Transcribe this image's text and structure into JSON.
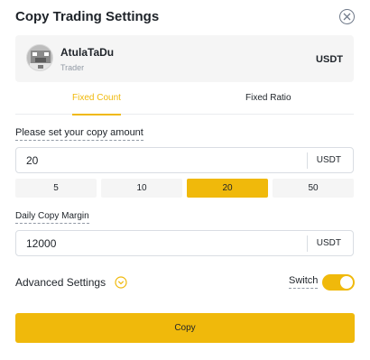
{
  "modal": {
    "title": "Copy Trading Settings",
    "close_icon": "close-circle-icon"
  },
  "trader": {
    "name": "AtulaTaDu",
    "role": "Trader",
    "asset": "USDT",
    "avatar_icon": "pixel-avatar"
  },
  "tabs": [
    {
      "label": "Fixed Count",
      "active": true
    },
    {
      "label": "Fixed Ratio",
      "active": false
    }
  ],
  "amount": {
    "label": "Please set your copy amount",
    "value": "20",
    "unit": "USDT",
    "presets": [
      "5",
      "10",
      "20",
      "50"
    ],
    "selected_preset": "20"
  },
  "margin": {
    "label": "Daily Copy Margin",
    "value": "12000",
    "unit": "USDT"
  },
  "advanced": {
    "label": "Advanced Settings",
    "icon": "chevron-down-circle-icon",
    "switch_label": "Switch",
    "switch_on": true
  },
  "actions": {
    "copy_label": "Copy"
  },
  "colors": {
    "accent": "#f0b90b",
    "text": "#1e2329",
    "muted": "#929aa5",
    "card_bg": "#f5f5f5"
  }
}
